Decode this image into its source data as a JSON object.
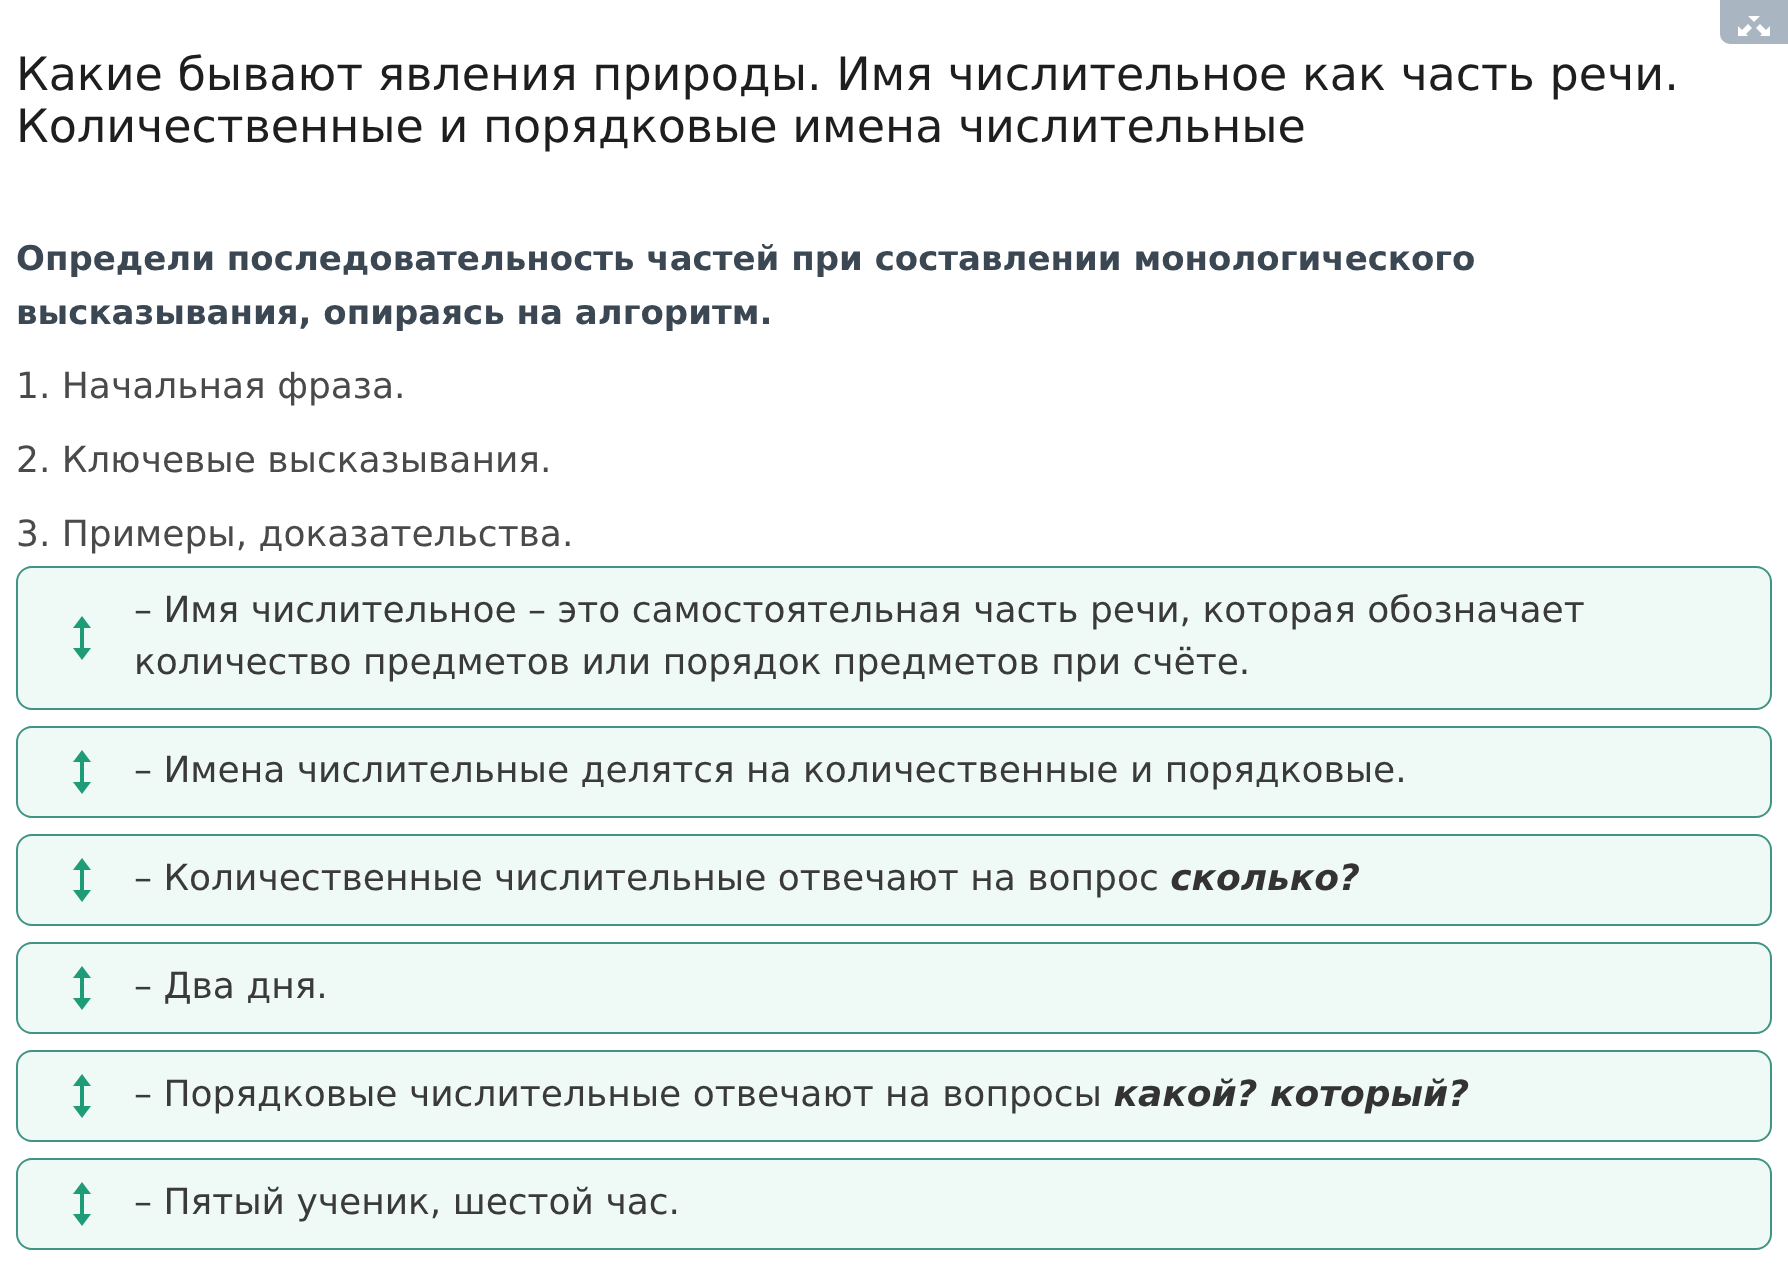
{
  "lesson": {
    "title": "Какие бывают явления природы. Имя числительное как часть речи. Количественные и порядковые имена числительные"
  },
  "task": {
    "question": "Определи последовательность частей при составлении монологического высказывания, опираясь на алгоритм.",
    "steps": [
      "1. Начальная фраза.",
      "2. Ключевые высказывания.",
      "3. Примеры, доказательства."
    ]
  },
  "cards": [
    "– Имя числительное – это самостоятельная часть речи, которая обозначает количество предметов или порядок предметов при счёте.",
    "– Имена числительные делятся на количественные и порядковые.",
    "– Количественные числительные отвечают на вопрос **сколько?**",
    "– Два дня.",
    "– Порядковые числительные отвечают на вопросы **какой? который?**",
    "– Пятый ученик, шестой час."
  ]
}
